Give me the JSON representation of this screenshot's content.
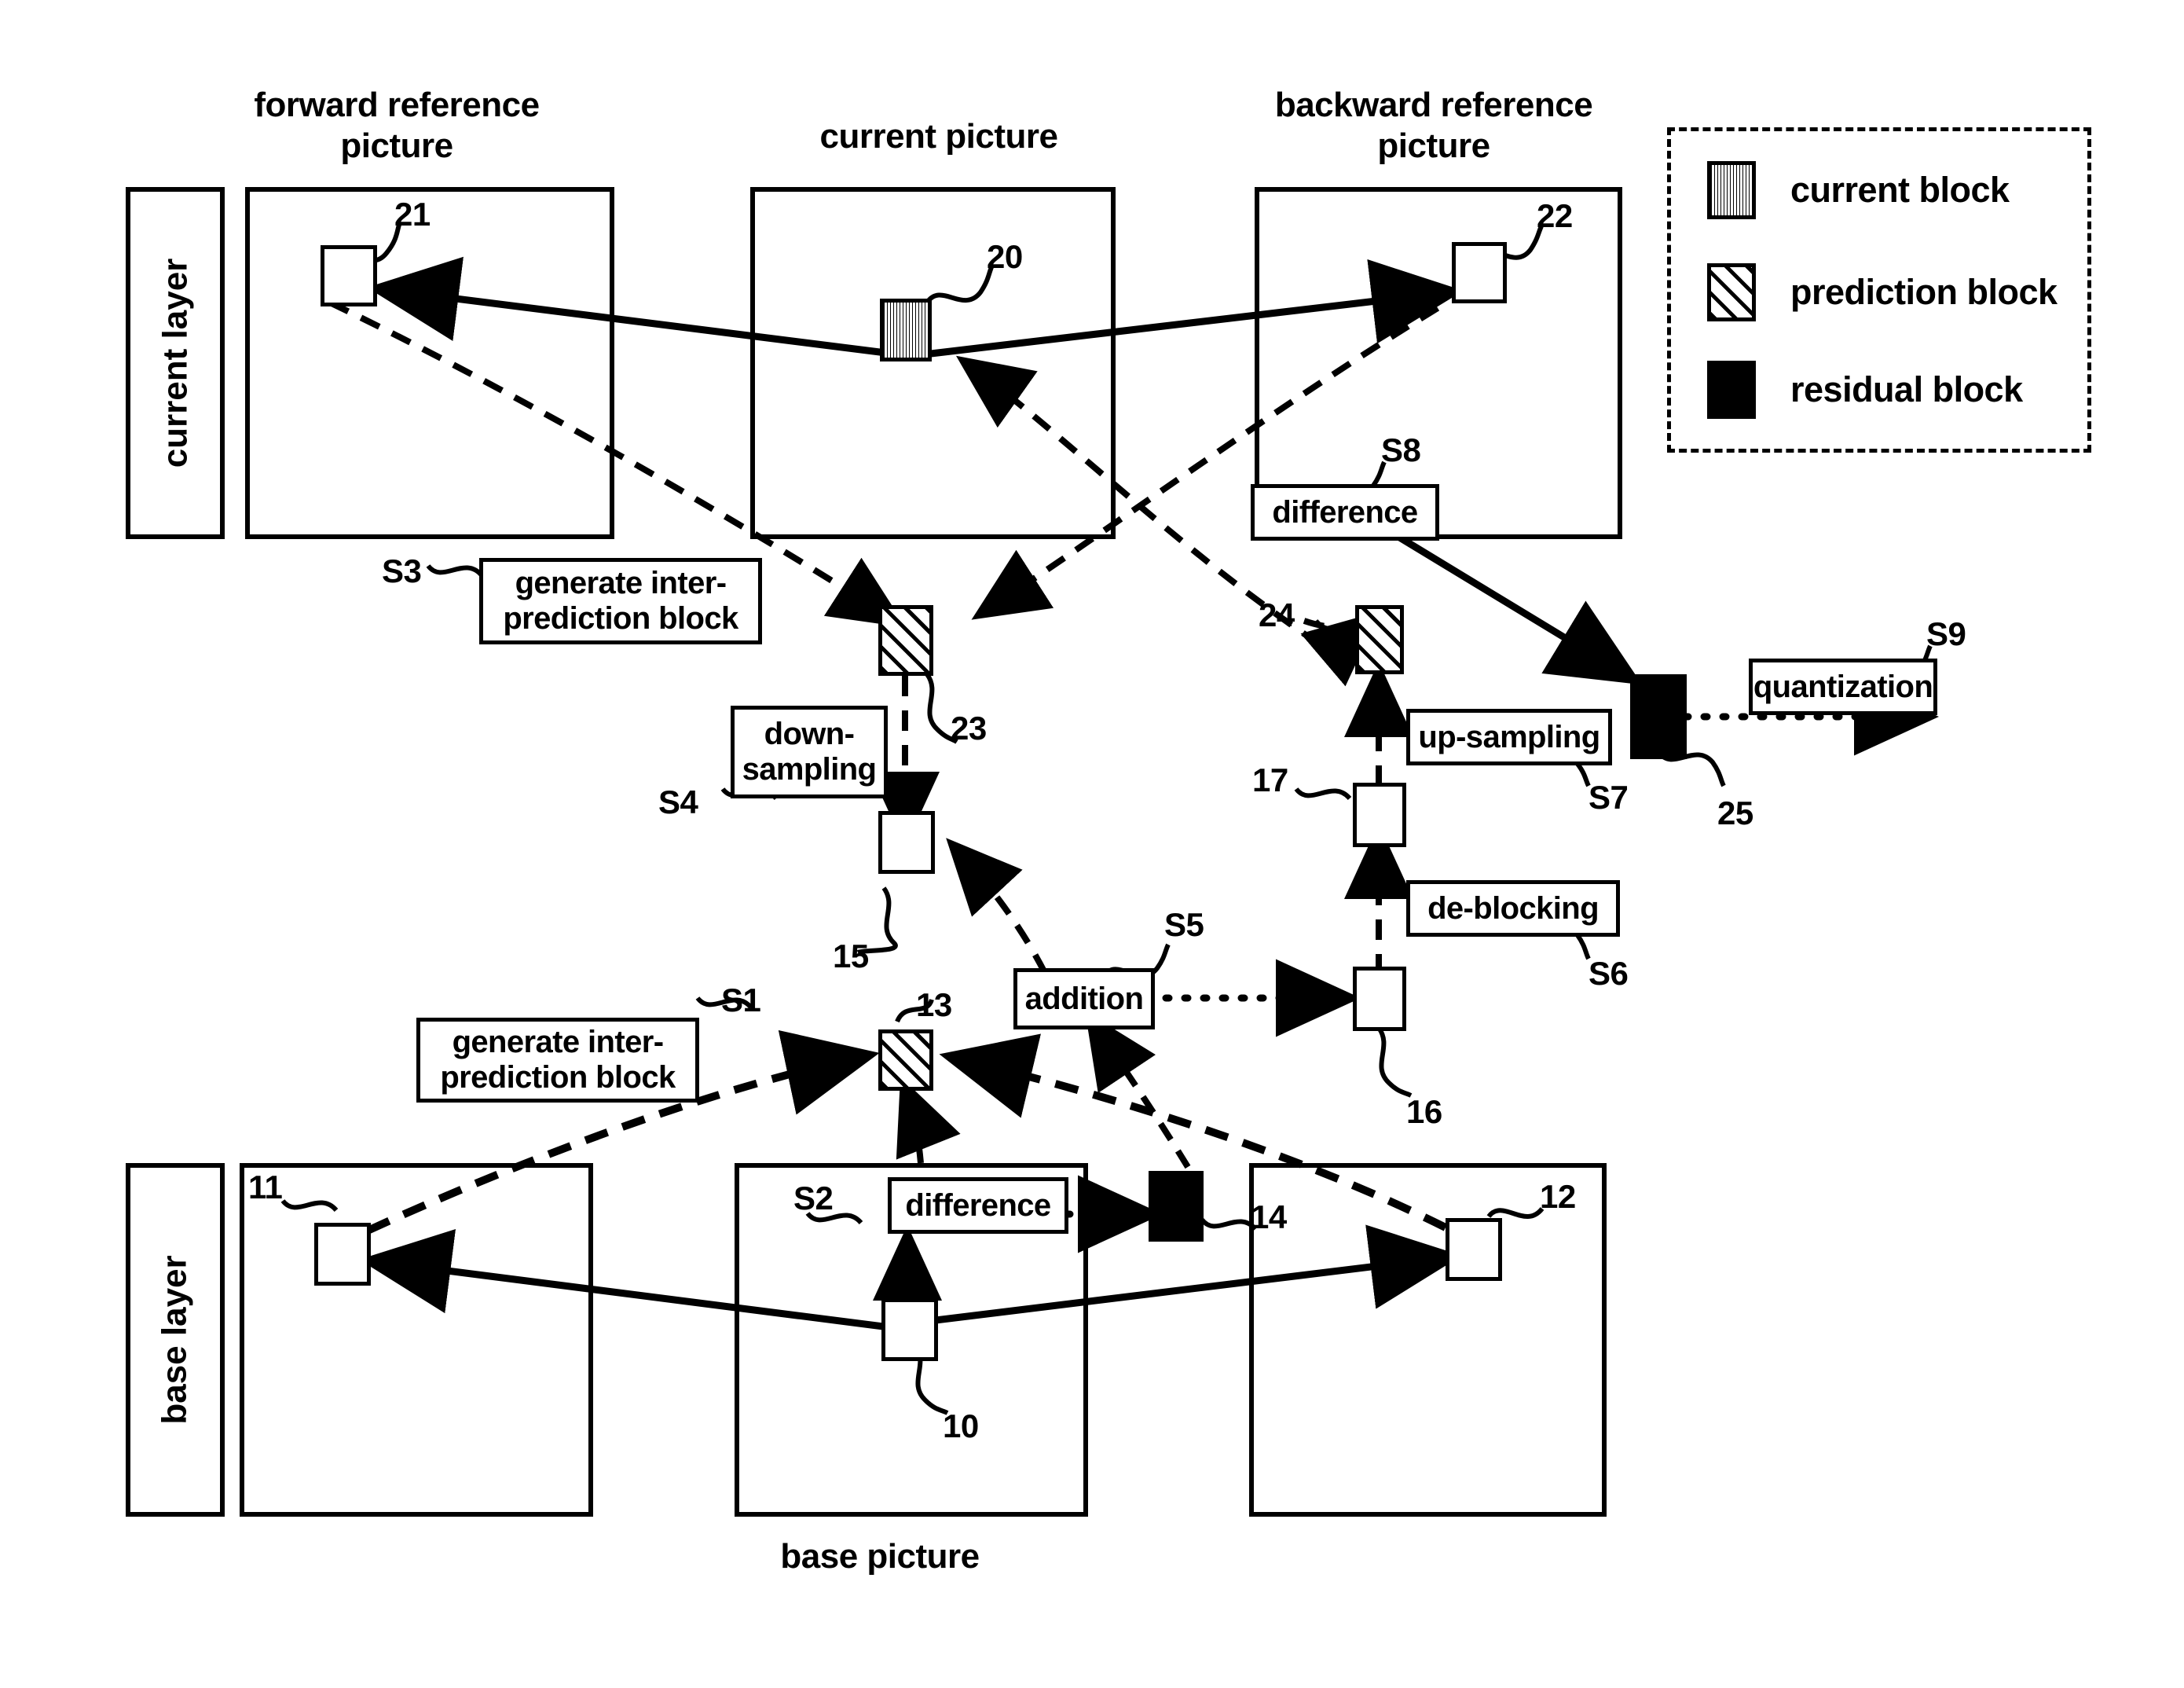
{
  "diagram": {
    "headers": {
      "forward_reference": "forward reference\npicture",
      "current_picture": "current picture",
      "backward_reference": "backward reference\npicture",
      "base_picture": "base picture"
    },
    "layer_labels": {
      "current_layer": "current layer",
      "base_layer": "base layer"
    },
    "legend": {
      "items": [
        {
          "swatch": "current-block-swatch",
          "label": "current block"
        },
        {
          "swatch": "prediction-block-swatch",
          "label": "prediction block"
        },
        {
          "swatch": "residual-block-swatch",
          "label": "residual block"
        }
      ]
    },
    "process_boxes": [
      {
        "id": "S1",
        "step": "S1",
        "label": "generate inter-\nprediction block"
      },
      {
        "id": "S2",
        "step": "S2",
        "label": "difference"
      },
      {
        "id": "S3",
        "step": "S3",
        "label": "generate inter-\nprediction block"
      },
      {
        "id": "S4",
        "step": "S4",
        "label": "down-\nsampling"
      },
      {
        "id": "S5",
        "step": "S5",
        "label": "addition"
      },
      {
        "id": "S6",
        "step": "S6",
        "label": "de-blocking"
      },
      {
        "id": "S7",
        "step": "S7",
        "label": "up-sampling"
      },
      {
        "id": "S8",
        "step": "S8",
        "label": "difference"
      },
      {
        "id": "S9",
        "step": "S9",
        "label": "quantization"
      }
    ],
    "step_tags": [
      "S1",
      "S2",
      "S3",
      "S4",
      "S5",
      "S6",
      "S7",
      "S8",
      "S9"
    ],
    "block_refs": {
      "b10": "10",
      "b11": "11",
      "b12": "12",
      "b13": "13",
      "b14": "14",
      "b15": "15",
      "b16": "16",
      "b17": "17",
      "b20": "20",
      "b21": "21",
      "b22": "22",
      "b23": "23",
      "b24": "24",
      "b25": "25"
    },
    "colors": {
      "ink": "#000000",
      "paper": "#ffffff"
    }
  }
}
